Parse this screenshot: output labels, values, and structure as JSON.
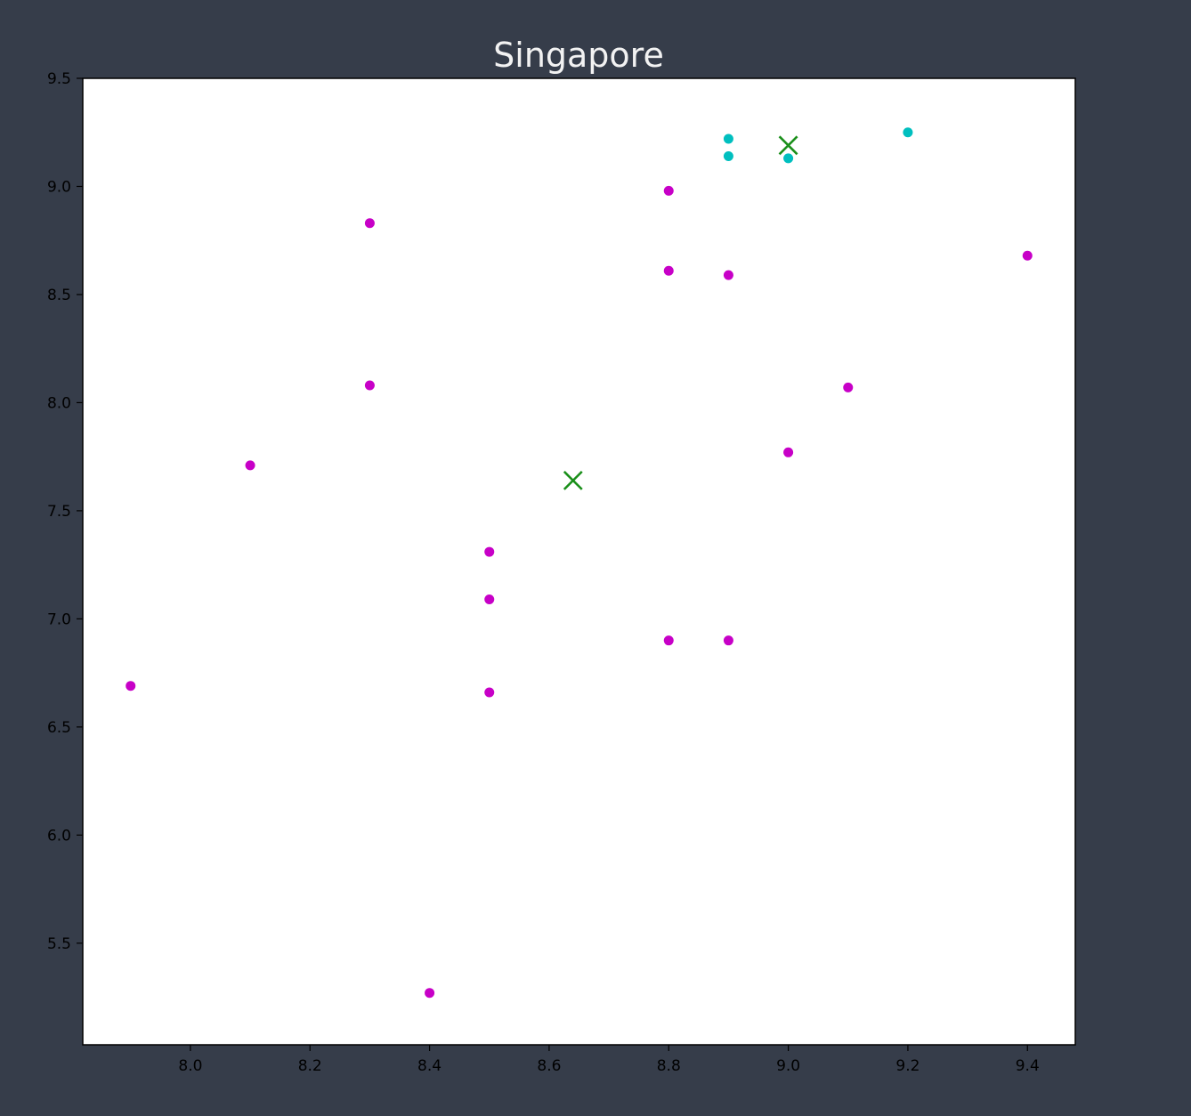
{
  "chart_data": {
    "type": "scatter",
    "title": "Singapore",
    "xlabel": "",
    "ylabel": "",
    "xlim": [
      7.82,
      9.48
    ],
    "ylim": [
      5.03,
      9.5
    ],
    "x_ticks": [
      "8.0",
      "8.2",
      "8.4",
      "8.6",
      "8.8",
      "9.0",
      "9.2",
      "9.4"
    ],
    "y_ticks": [
      "5.5",
      "6.0",
      "6.5",
      "7.0",
      "7.5",
      "8.0",
      "8.5",
      "9.0",
      "9.5"
    ],
    "grid": false,
    "legend": "none",
    "series": [
      {
        "color": "#c700c7",
        "marker": "circle",
        "points": [
          {
            "x": 7.9,
            "y": 6.69
          },
          {
            "x": 8.1,
            "y": 7.71
          },
          {
            "x": 8.3,
            "y": 8.83
          },
          {
            "x": 8.3,
            "y": 8.08
          },
          {
            "x": 8.4,
            "y": 5.27
          },
          {
            "x": 8.5,
            "y": 7.31
          },
          {
            "x": 8.5,
            "y": 7.09
          },
          {
            "x": 8.5,
            "y": 6.66
          },
          {
            "x": 8.8,
            "y": 8.98
          },
          {
            "x": 8.8,
            "y": 8.61
          },
          {
            "x": 8.8,
            "y": 6.9
          },
          {
            "x": 8.9,
            "y": 8.59
          },
          {
            "x": 8.9,
            "y": 6.9
          },
          {
            "x": 9.0,
            "y": 7.77
          },
          {
            "x": 9.1,
            "y": 8.07
          },
          {
            "x": 9.4,
            "y": 8.68
          }
        ]
      },
      {
        "color": "#00bfbf",
        "marker": "circle",
        "points": [
          {
            "x": 8.9,
            "y": 9.22
          },
          {
            "x": 8.9,
            "y": 9.14
          },
          {
            "x": 9.0,
            "y": 9.13
          },
          {
            "x": 9.2,
            "y": 9.25
          }
        ]
      },
      {
        "color": "#1a8f1a",
        "marker": "x",
        "points": [
          {
            "x": 8.64,
            "y": 7.64
          },
          {
            "x": 9.0,
            "y": 9.19
          }
        ]
      }
    ]
  }
}
